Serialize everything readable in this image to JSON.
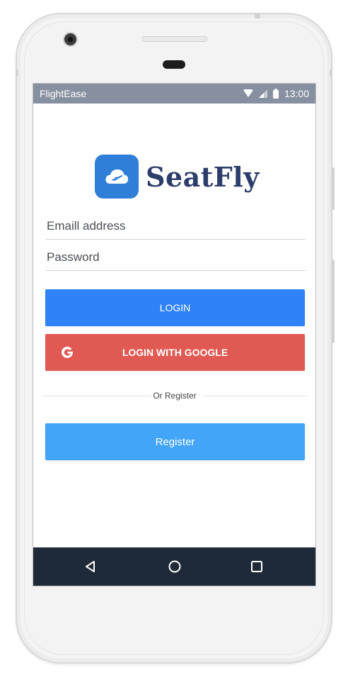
{
  "status_bar": {
    "app_name": "FlightEase",
    "time": "13:00",
    "icons": [
      "wifi-icon",
      "signal-icon",
      "battery-icon"
    ]
  },
  "logo": {
    "name": "SeatFly",
    "icon": "cloud-airplane-icon",
    "brand_color": "#2f7fd8",
    "text_color": "#2c3d6b"
  },
  "form": {
    "email_placeholder": "Emaill address",
    "password_placeholder": "Password"
  },
  "buttons": {
    "login_label": "LOGIN",
    "login_color": "#2f82f7",
    "google_label": "LOGIN WITH GOOGLE",
    "google_icon": "google-g-icon",
    "google_color": "#e05a53",
    "divider_label": "Or Register",
    "register_label": "Register",
    "register_color": "#42a5f8"
  },
  "nav": {
    "back_icon": "back-triangle-icon",
    "home_icon": "home-circle-icon",
    "recents_icon": "recents-square-icon"
  }
}
